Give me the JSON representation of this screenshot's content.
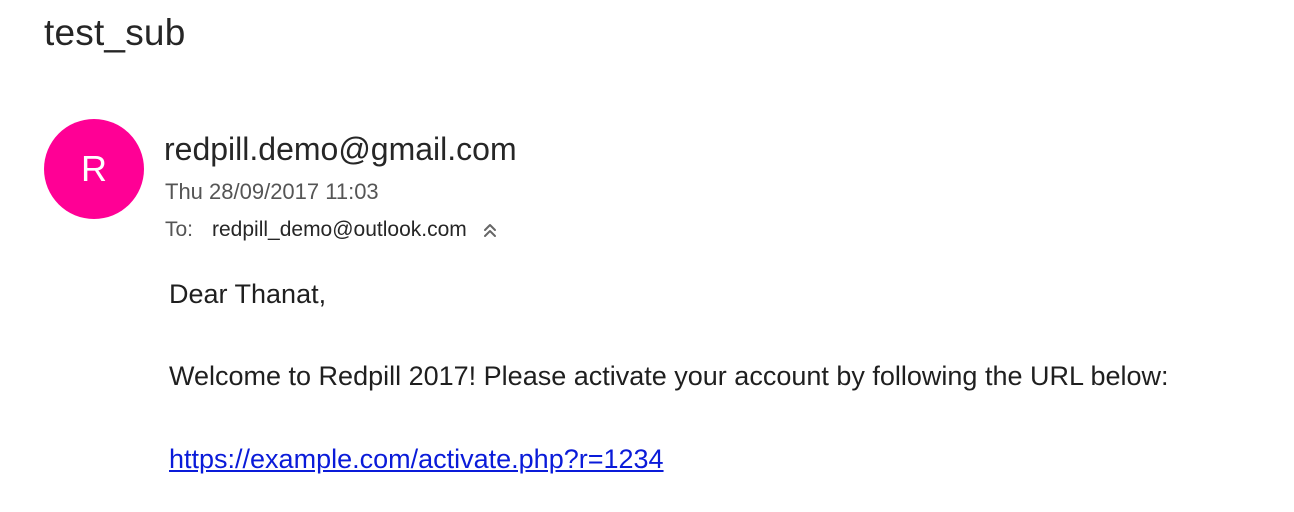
{
  "email": {
    "subject": "test_sub",
    "avatar_initial": "R",
    "avatar_color": "#ff0095",
    "sender": "redpill.demo@gmail.com",
    "date": "Thu 28/09/2017 11:03",
    "to_label": "To:",
    "to_address": "redpill_demo@outlook.com",
    "expand_icon": "double-chevron-up-icon",
    "body": {
      "greeting": "Dear Thanat,",
      "welcome": "Welcome to Redpill 2017! Please activate your account by following the URL below:",
      "link": "https://example.com/activate.php?r=1234"
    },
    "link_color": "#0a1bd9"
  }
}
